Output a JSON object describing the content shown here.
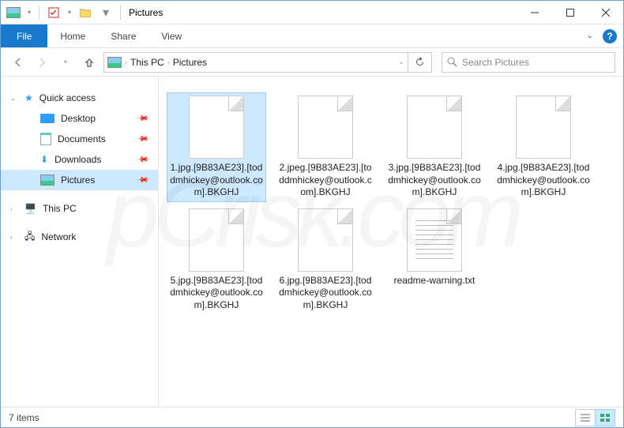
{
  "title": "Pictures",
  "ribbon": {
    "file": "File",
    "tabs": [
      "Home",
      "Share",
      "View"
    ]
  },
  "breadcrumbs": [
    "This PC",
    "Pictures"
  ],
  "search_placeholder": "Search Pictures",
  "nav": {
    "quick": {
      "label": "Quick access",
      "items": [
        {
          "label": "Desktop"
        },
        {
          "label": "Documents"
        },
        {
          "label": "Downloads"
        },
        {
          "label": "Pictures",
          "selected": true
        }
      ]
    },
    "thispc": "This PC",
    "network": "Network"
  },
  "files": [
    {
      "name": "1.jpg.[9B83AE23].[toddmhickey@outlook.com].BKGHJ",
      "selected": true
    },
    {
      "name": "2.jpeg.[9B83AE23].[toddmhickey@outlook.com].BKGHJ"
    },
    {
      "name": "3.jpg.[9B83AE23].[toddmhickey@outlook.com].BKGHJ"
    },
    {
      "name": "4.jpg.[9B83AE23].[toddmhickey@outlook.com].BKGHJ"
    },
    {
      "name": "5.jpg.[9B83AE23].[toddmhickey@outlook.com].BKGHJ"
    },
    {
      "name": "6.jpg.[9B83AE23].[toddmhickey@outlook.com].BKGHJ"
    },
    {
      "name": "readme-warning.txt",
      "txt": true
    }
  ],
  "status": "7 items",
  "watermark": "pCrisk.com"
}
